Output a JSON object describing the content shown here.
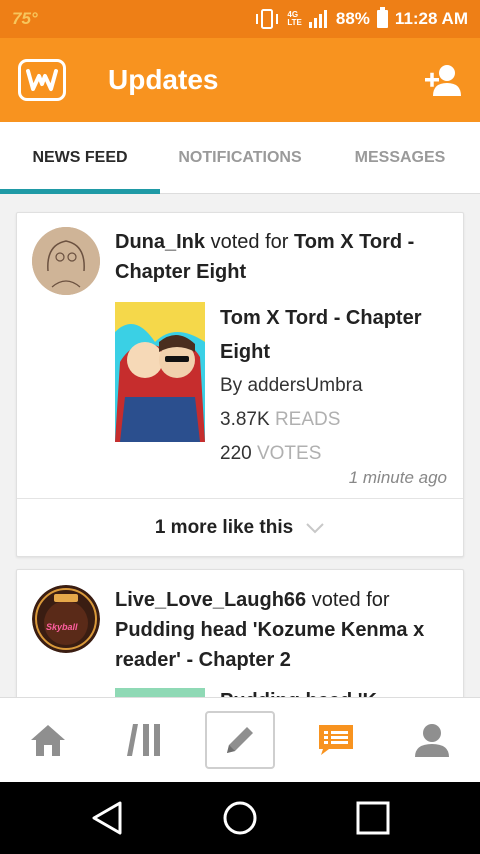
{
  "status_bar": {
    "temperature": "75°",
    "network_top": "4G",
    "network_bottom": "LTE",
    "battery": "88%",
    "time": "11:28 AM"
  },
  "header": {
    "title": "Updates"
  },
  "tabs": [
    {
      "label": "NEWS FEED",
      "active": true
    },
    {
      "label": "NOTIFICATIONS",
      "active": false
    },
    {
      "label": "MESSAGES",
      "active": false
    }
  ],
  "feed": [
    {
      "user": "Duna_Ink",
      "action": " voted for ",
      "target": "Tom X Tord - Chapter Eight",
      "story": {
        "title": "Tom X Tord - Chapter Eight",
        "author": "By addersUmbra",
        "reads_value": "3.87K",
        "reads_label": "READS",
        "votes_value": "220",
        "votes_label": "VOTES"
      },
      "time": "1 minute ago",
      "more_label": "1 more like this"
    },
    {
      "user": "Live_Love_Laugh66",
      "action": " voted for ",
      "target": "Pudding head 'Kozume Kenma x reader' - Chapter 2",
      "avatar_text": "Skyball",
      "story_title_partial": "Pudding head 'K..."
    }
  ],
  "bottom_nav": [
    {
      "icon": "home-icon"
    },
    {
      "icon": "library-icon"
    },
    {
      "icon": "pencil-icon"
    },
    {
      "icon": "updates-icon",
      "active": true
    },
    {
      "icon": "profile-icon"
    }
  ],
  "colors": {
    "status_bar": "#ee7f16",
    "header": "#f8931f",
    "tab_indicator": "#1f9aa6",
    "active_nav": "#f8931f"
  }
}
